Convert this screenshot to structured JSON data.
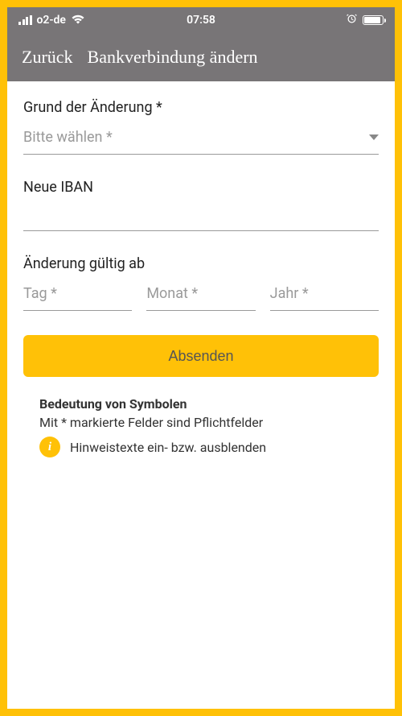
{
  "status": {
    "carrier": "o2-de",
    "time": "07:58"
  },
  "header": {
    "back": "Zurück",
    "title": "Bankverbindung ändern"
  },
  "form": {
    "reason": {
      "label": "Grund der Änderung *",
      "placeholder": "Bitte wählen *"
    },
    "iban": {
      "label": "Neue IBAN"
    },
    "validFrom": {
      "label": "Änderung gültig ab",
      "day": "Tag *",
      "month": "Monat *",
      "year": "Jahr *"
    },
    "submit": "Absenden"
  },
  "legend": {
    "title": "Bedeutung von Symbolen",
    "required": "Mit * markierte Felder sind Pflichtfelder",
    "info": "Hinweistexte ein- bzw. ausblenden",
    "info_symbol": "i"
  }
}
